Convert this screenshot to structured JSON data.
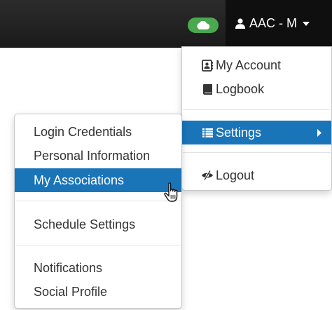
{
  "navbar": {
    "user_label": "AAC - M"
  },
  "user_menu": {
    "items": [
      {
        "label": "My Account",
        "icon": "address-card-icon"
      },
      {
        "label": "Logbook",
        "icon": "book-icon"
      },
      {
        "label": "Settings",
        "icon": "list-icon",
        "active": true
      },
      {
        "label": "Logout",
        "icon": "eye-slash-icon"
      }
    ]
  },
  "settings_submenu": {
    "items": [
      {
        "label": "Login Credentials"
      },
      {
        "label": "Personal Information"
      },
      {
        "label": "My Associations",
        "active": true
      },
      {
        "label": "Schedule Settings"
      },
      {
        "label": "Notifications"
      },
      {
        "label": "Social Profile"
      }
    ]
  },
  "colors": {
    "navbar_bg": "#1b1b1b",
    "cloud_badge": "#4aa84f",
    "active_item": "#1a74b8"
  }
}
